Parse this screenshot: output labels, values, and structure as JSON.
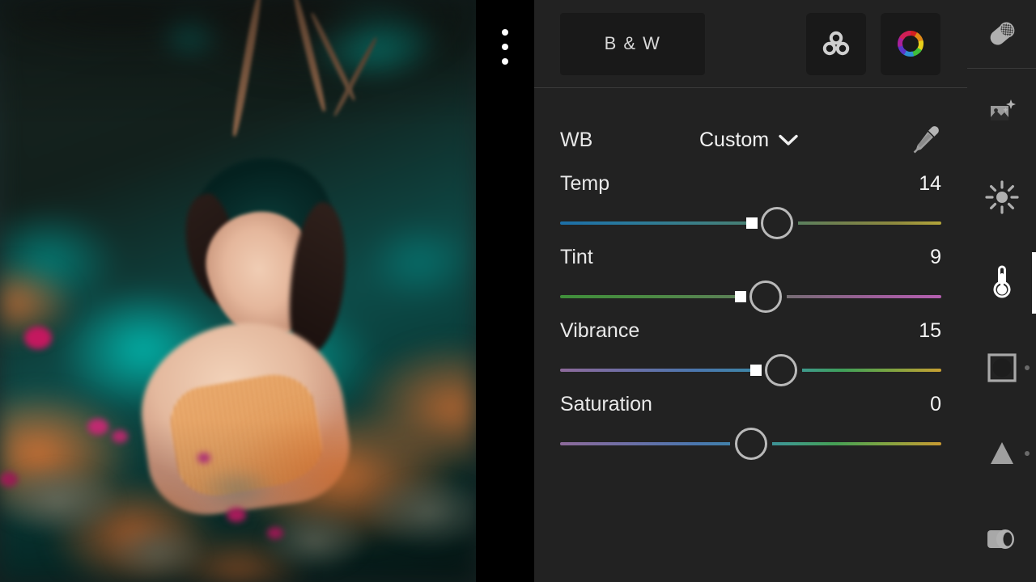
{
  "app": {
    "theme_bg": "#222222",
    "panel_bg": "#222222",
    "button_bg": "#191919",
    "accent": "#ffffff"
  },
  "canvas": {
    "menu_name": "more-options",
    "menu_dots": 3,
    "photo_alt": "Portrait of a smiling woman in an orange dress amid flowers with teal bokeh background"
  },
  "toolbar": {
    "bw_label": "B & W",
    "color_mix_icon": "color-mix-icon",
    "color_wheel_icon": "color-wheel-icon"
  },
  "white_balance": {
    "label": "WB",
    "value": "Custom",
    "chevron_icon": "chevron-down-icon",
    "eyedropper_icon": "eyedropper-icon"
  },
  "sliders": [
    {
      "label": "Temp",
      "value": "14",
      "pct": 57,
      "gradient": "linear-gradient(90deg,#1c6fa8 0%,#2a7a9c 18%,#3d7f84 38%,#4c7f6a 55%,#6f8050 72%,#8f8a3e 88%,#b3a53a 100%)",
      "name": "slider-temp"
    },
    {
      "label": "Tint",
      "value": "9",
      "pct": 54,
      "gradient": "linear-gradient(90deg,#3f8f3a 0%,#4d8a45 25%,#5c7f58 48%,#7a6a78 62%,#9c5f99 82%,#b45fb0 100%)",
      "name": "slider-tint"
    },
    {
      "label": "Vibrance",
      "value": "15",
      "pct": 58,
      "gradient": "linear-gradient(90deg,#8d6a9a 0%,#6d6fa6 18%,#4a77ae 36%,#3d87a6 52%,#3f9a8a 64%,#3fa05a 74%,#74a544 85%,#c8a032 100%)",
      "name": "slider-vibrance"
    },
    {
      "label": "Saturation",
      "value": "0",
      "pct": 50,
      "gradient": "linear-gradient(90deg,#8d6a9a 0%,#6d6fa6 18%,#4a77ae 36%,#3d87a6 50%,#3f9a8a 60%,#45a055 72%,#7ba544 84%,#c89a32 100%)",
      "name": "slider-saturation"
    }
  ],
  "rail": {
    "top_tool": {
      "name": "healing-icon",
      "label": "Healing"
    },
    "items": [
      {
        "name": "auto-enhance-icon",
        "label": "Auto",
        "active": false,
        "dot": false
      },
      {
        "name": "light-icon",
        "label": "Light",
        "active": false,
        "dot": false
      },
      {
        "name": "color-icon",
        "label": "Color",
        "active": true,
        "dot": false
      },
      {
        "name": "effects-icon",
        "label": "Effects",
        "active": false,
        "dot": true
      },
      {
        "name": "detail-icon",
        "label": "Detail",
        "active": false,
        "dot": true
      },
      {
        "name": "optics-icon",
        "label": "Optics",
        "active": false,
        "dot": false
      }
    ]
  }
}
